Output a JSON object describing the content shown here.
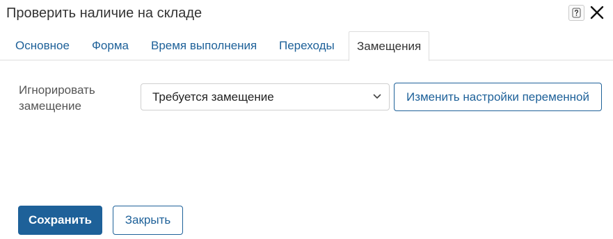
{
  "dialog": {
    "title": "Проверить наличие на складе",
    "help_icon": "question-icon",
    "close_icon": "close-icon"
  },
  "tabs": [
    {
      "label": "Основное",
      "active": false
    },
    {
      "label": "Форма",
      "active": false
    },
    {
      "label": "Время выполнения",
      "active": false
    },
    {
      "label": "Переходы",
      "active": false
    },
    {
      "label": "Замещения",
      "active": true
    }
  ],
  "form": {
    "ignore_replacement": {
      "label": "Игнорировать замещение",
      "value": "Требуется замещение",
      "icon": "chevron-down-icon"
    },
    "change_settings_label": "Изменить настройки переменной"
  },
  "footer": {
    "save_label": "Сохранить",
    "close_label": "Закрыть"
  },
  "colors": {
    "accent": "#1e6199",
    "border": "#dddddd",
    "text": "#333333"
  }
}
